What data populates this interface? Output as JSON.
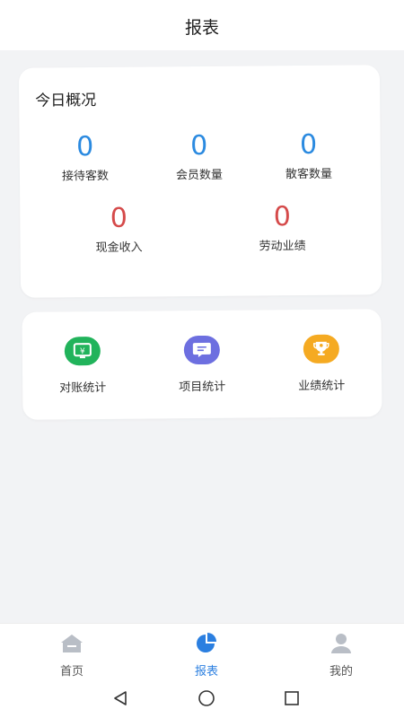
{
  "header": {
    "title": "报表"
  },
  "overview": {
    "title": "今日概况",
    "stats": [
      {
        "value": "0",
        "label": "接待客数"
      },
      {
        "value": "0",
        "label": "会员数量"
      },
      {
        "value": "0",
        "label": "散客数量"
      },
      {
        "value": "0",
        "label": "现金收入"
      },
      {
        "value": "0",
        "label": "劳动业绩"
      }
    ]
  },
  "tools": [
    {
      "label": "对账统计",
      "icon": "reconciliation-icon",
      "color": "#21b35b"
    },
    {
      "label": "项目统计",
      "icon": "chat-list-icon",
      "color": "#6d6fe0"
    },
    {
      "label": "业绩统计",
      "icon": "trophy-icon",
      "color": "#f5aa22"
    }
  ],
  "bottom_nav": {
    "items": [
      {
        "label": "首页",
        "icon": "home-icon"
      },
      {
        "label": "报表",
        "icon": "pie-chart-icon",
        "active": true
      },
      {
        "label": "我的",
        "icon": "user-icon"
      }
    ]
  },
  "colors": {
    "accent_blue": "#2b8ae0",
    "stat_red": "#d54a4a",
    "background": "#f2f3f5"
  }
}
